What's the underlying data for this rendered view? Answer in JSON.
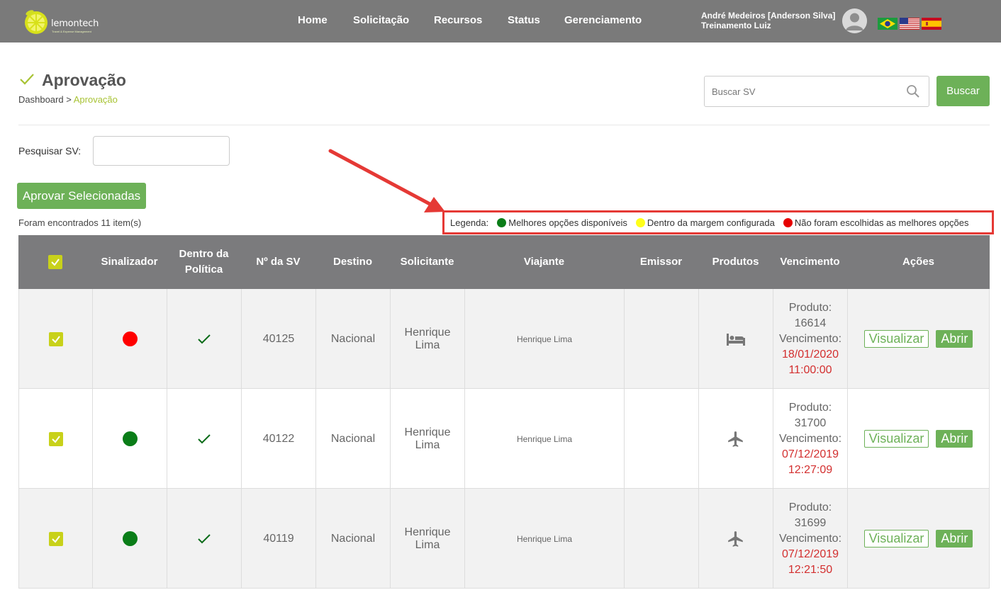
{
  "header": {
    "logo_text": "lemontech",
    "logo_sub": "Travel & Expense Management",
    "nav": [
      {
        "label": "Home"
      },
      {
        "label": "Solicitação"
      },
      {
        "label": "Recursos"
      },
      {
        "label": "Status"
      },
      {
        "label": "Gerenciamento"
      }
    ],
    "user_name": "André Medeiros [Anderson Silva]",
    "user_sub": "Treinamento Luiz",
    "flags": [
      "brazil-flag-icon",
      "usa-flag-icon",
      "spain-flag-icon"
    ]
  },
  "page": {
    "title": "Aprovação",
    "breadcrumb_home": "Dashboard",
    "breadcrumb_sep": ">",
    "breadcrumb_current": "Aprovação"
  },
  "search": {
    "placeholder": "Buscar SV",
    "button": "Buscar"
  },
  "filter": {
    "label": "Pesquisar SV:",
    "value": ""
  },
  "actions": {
    "approve_selected": "Aprovar Selecionadas"
  },
  "found_text": "Foram encontrados 11 item(s)",
  "legend": {
    "title": "Legenda:",
    "items": [
      {
        "label": "Melhores opções disponíveis",
        "color": "#0a7d18"
      },
      {
        "label": "Dentro da margem configurada",
        "color": "#ffff1a"
      },
      {
        "label": "Não foram escolhidas as melhores opções",
        "color": "#e60000"
      }
    ]
  },
  "colors": {
    "header_bg": "#7a7a7a",
    "accent_green": "#6db158",
    "lime": "#c8d11a",
    "annotation_red": "#e53935"
  },
  "table": {
    "headers": [
      "",
      "Sinalizador",
      "Dentro da Política",
      "Nº da SV",
      "Destino",
      "Solicitante",
      "Viajante",
      "Emissor",
      "Produtos",
      "Vencimento",
      "Ações"
    ],
    "rows": [
      {
        "signal": "#ff0000",
        "sv": "40125",
        "destino": "Nacional",
        "solicitante": "Henrique Lima",
        "viajante": "Henrique Lima",
        "emissor": "",
        "product_icon": "hotel-bed-icon",
        "produto_label": "Produto:",
        "produto_num": "16614",
        "venc_label": "Vencimento:",
        "venc_date": "18/01/2020",
        "venc_time": "11:00:00",
        "btn_view": "Visualizar",
        "btn_open": "Abrir"
      },
      {
        "signal": "#0a7d18",
        "sv": "40122",
        "destino": "Nacional",
        "solicitante": "Henrique Lima",
        "viajante": "Henrique Lima",
        "emissor": "",
        "product_icon": "airplane-icon",
        "produto_label": "Produto:",
        "produto_num": "31700",
        "venc_label": "Vencimento:",
        "venc_date": "07/12/2019",
        "venc_time": "12:27:09",
        "btn_view": "Visualizar",
        "btn_open": "Abrir"
      },
      {
        "signal": "#0a7d18",
        "sv": "40119",
        "destino": "Nacional",
        "solicitante": "Henrique Lima",
        "viajante": "Henrique Lima",
        "emissor": "",
        "product_icon": "airplane-icon",
        "produto_label": "Produto:",
        "produto_num": "31699",
        "venc_label": "Vencimento:",
        "venc_date": "07/12/2019",
        "venc_time": "12:21:50",
        "btn_view": "Visualizar",
        "btn_open": "Abrir"
      }
    ]
  }
}
